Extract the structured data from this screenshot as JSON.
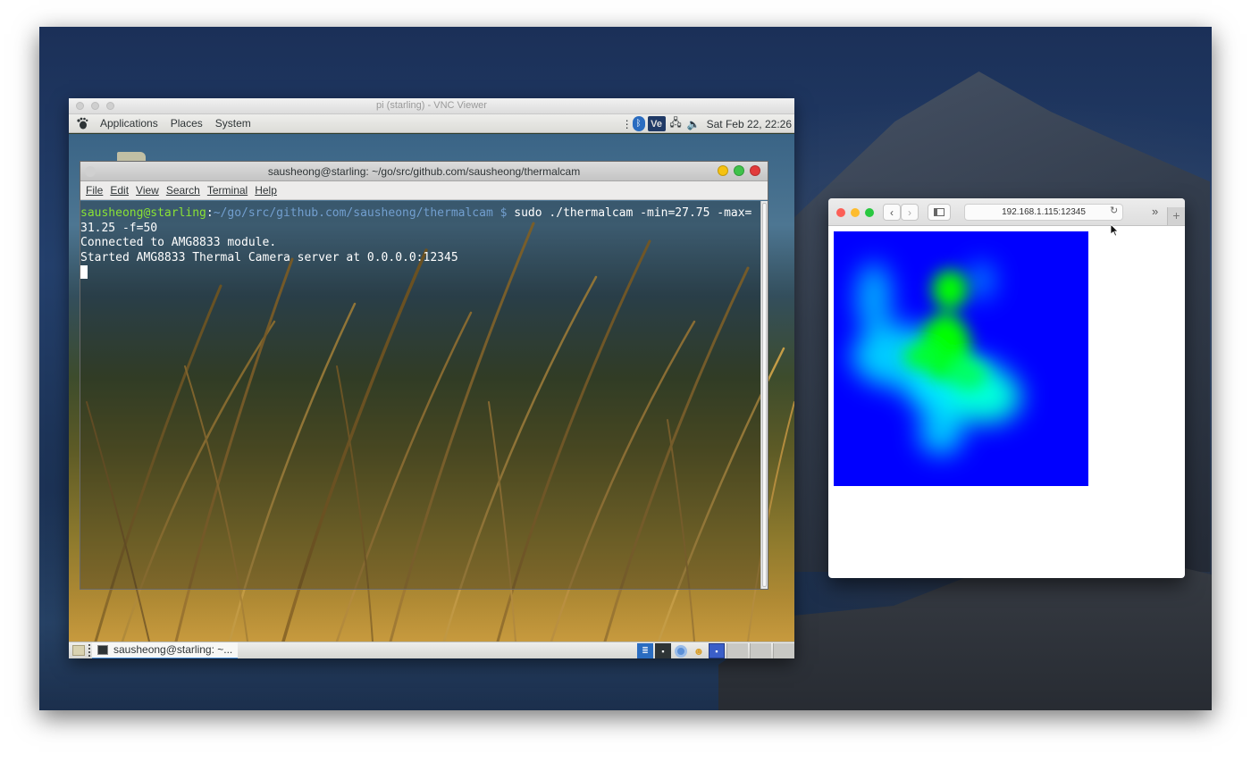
{
  "vnc_window": {
    "title": "pi (starling) - VNC Viewer"
  },
  "top_panel": {
    "menus": [
      "Applications",
      "Places",
      "System"
    ],
    "tray_icons": [
      "dots-icon",
      "bluetooth-icon",
      "vnc-icon",
      "network-icon",
      "volume-icon"
    ],
    "clock": "Sat Feb 22, 22:26"
  },
  "terminal": {
    "title": "sausheong@starling: ~/go/src/github.com/sausheong/thermalcam",
    "menus": [
      "File",
      "Edit",
      "View",
      "Search",
      "Terminal",
      "Help"
    ],
    "prompt_user": "sausheong@starling",
    "prompt_sep": ":",
    "prompt_path": "~/go/src/github.com/sausheong/thermalcam",
    "prompt_symbol": " $ ",
    "command_line1": "sudo ./thermalcam -min=27.75 -max=",
    "command_line2": "31.25 -f=50",
    "output": [
      "Connected to AMG8833 module.",
      "Started AMG8833 Thermal Camera server at 0.0.0.0:12345"
    ]
  },
  "bottom_panel": {
    "task_label": "sausheong@starling: ~..."
  },
  "browser": {
    "url": "192.168.1.115:12345"
  },
  "thermal_image": {
    "background_color": "#0000ff",
    "hot_color": "#00ff00",
    "warm_color": "#00ffff"
  }
}
